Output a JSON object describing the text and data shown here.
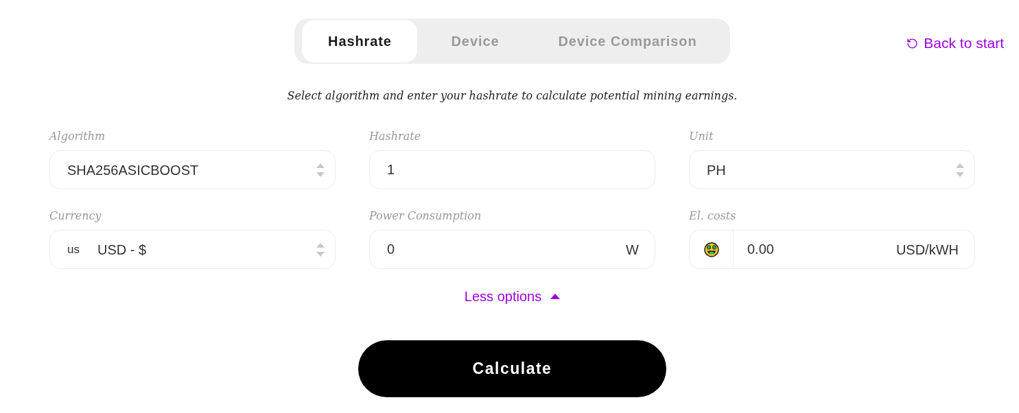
{
  "tabs": [
    {
      "label": "Hashrate",
      "selected": true
    },
    {
      "label": "Device",
      "selected": false
    },
    {
      "label": "Device Comparison",
      "selected": false
    }
  ],
  "back_link": {
    "label": "Back to start"
  },
  "subtitle": "Select algorithm and enter your hashrate to calculate potential mining earnings.",
  "fields": [
    {
      "kind": "select",
      "label": "Algorithm",
      "value": "SHA256ASICBOOST"
    },
    {
      "kind": "input",
      "label": "Hashrate",
      "value": "1"
    },
    {
      "kind": "select",
      "label": "Unit",
      "value": "PH"
    },
    {
      "kind": "select",
      "label": "Currency",
      "prefix": "us",
      "value": "USD - $"
    },
    {
      "kind": "input",
      "label": "Power Consumption",
      "value": "0",
      "suffix": "W"
    },
    {
      "kind": "emoji_input",
      "label": "El. costs",
      "value": "0.00",
      "suffix": "USD/kWH"
    }
  ],
  "options_toggle": {
    "label": "Less options",
    "expanded": true
  },
  "submit_button": {
    "label": "Calculate"
  }
}
